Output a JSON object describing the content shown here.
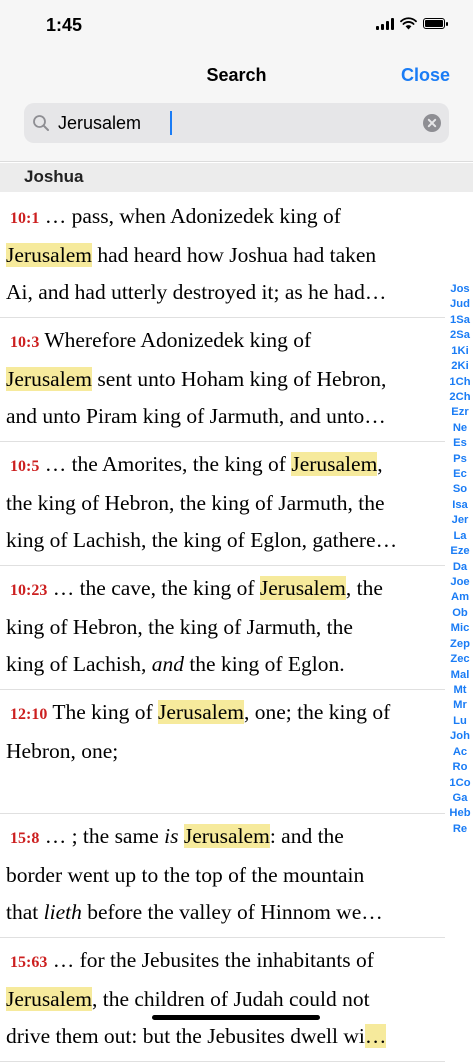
{
  "status_bar": {
    "time": "1:45"
  },
  "nav": {
    "title": "Search",
    "close_label": "Close"
  },
  "search": {
    "value": "Jerusalem",
    "placeholder": ""
  },
  "section": {
    "title": "Joshua"
  },
  "results": [
    {
      "ref": "10:1",
      "lines": [
        [
          {
            "t": "… pass, when Adonizedek king of"
          }
        ],
        [
          {
            "t": "Jerusalem",
            "h": true
          },
          {
            "t": " had heard how Joshua had taken"
          }
        ],
        [
          {
            "t": "Ai, and had utterly destroyed it; as he had…"
          }
        ]
      ]
    },
    {
      "ref": "10:3",
      "lines": [
        [
          {
            "t": "Wherefore Adonizedek king of"
          }
        ],
        [
          {
            "t": "Jerusalem",
            "h": true
          },
          {
            "t": " sent unto Hoham king of Hebron,"
          }
        ],
        [
          {
            "t": "and unto Piram king of Jarmuth, and unto…"
          }
        ]
      ]
    },
    {
      "ref": "10:5",
      "lines": [
        [
          {
            "t": "… the Amorites, the king of "
          },
          {
            "t": "Jerusalem",
            "h": true
          },
          {
            "t": ","
          }
        ],
        [
          {
            "t": "the king of Hebron, the king of Jarmuth, the"
          }
        ],
        [
          {
            "t": "king of Lachish, the king of Eglon, gathere…"
          }
        ]
      ]
    },
    {
      "ref": "10:23",
      "lines": [
        [
          {
            "t": "… the cave, the king of "
          },
          {
            "t": "Jerusalem",
            "h": true
          },
          {
            "t": ", the"
          }
        ],
        [
          {
            "t": "king of Hebron, the king of Jarmuth, the"
          }
        ],
        [
          {
            "t": "king of Lachish, "
          },
          {
            "t": "and",
            "i": true
          },
          {
            "t": " the king of Eglon."
          }
        ]
      ]
    },
    {
      "ref": "12:10",
      "lines": [
        [
          {
            "t": "The king of "
          },
          {
            "t": "Jerusalem",
            "h": true
          },
          {
            "t": ", one; the king of"
          }
        ],
        [
          {
            "t": "Hebron, one;"
          }
        ],
        [
          {
            "t": ""
          }
        ]
      ]
    },
    {
      "ref": "15:8",
      "lines": [
        [
          {
            "t": "… ; the same "
          },
          {
            "t": "is",
            "i": true
          },
          {
            "t": " "
          },
          {
            "t": "Jerusalem",
            "h": true
          },
          {
            "t": ": and the"
          }
        ],
        [
          {
            "t": "border went up to the top of the mountain"
          }
        ],
        [
          {
            "t": "that "
          },
          {
            "t": "lieth",
            "i": true
          },
          {
            "t": " before the valley of Hinnom we…"
          }
        ]
      ]
    },
    {
      "ref": "15:63",
      "lines": [
        [
          {
            "t": "… for the Jebusites the inhabitants of"
          }
        ],
        [
          {
            "t": "Jerusalem",
            "h": true
          },
          {
            "t": ", the children of Judah could not"
          }
        ],
        [
          {
            "t": "drive them out: but the Jebusites dwell wi"
          },
          {
            "t": "…",
            "h": true
          }
        ]
      ]
    }
  ],
  "index_bar": [
    "Jos",
    "Jud",
    "1Sa",
    "2Sa",
    "1Ki",
    "2Ki",
    "1Ch",
    "2Ch",
    "Ezr",
    "Ne",
    "Es",
    "Ps",
    "Ec",
    "So",
    "Isa",
    "Jer",
    "La",
    "Eze",
    "Da",
    "Joe",
    "Am",
    "Ob",
    "Mic",
    "Zep",
    "Zec",
    "Mal",
    "Mt",
    "Mr",
    "Lu",
    "Joh",
    "Ac",
    "Ro",
    "1Co",
    "Ga",
    "Heb",
    "Re"
  ],
  "colors": {
    "accent": "#1a7cf5",
    "highlight": "#f6ea9c",
    "reference": "#cc1f1f"
  },
  "icons": {
    "search": "search-icon",
    "clear": "clear-circle-icon",
    "wifi": "wifi-icon",
    "battery": "battery-icon"
  }
}
